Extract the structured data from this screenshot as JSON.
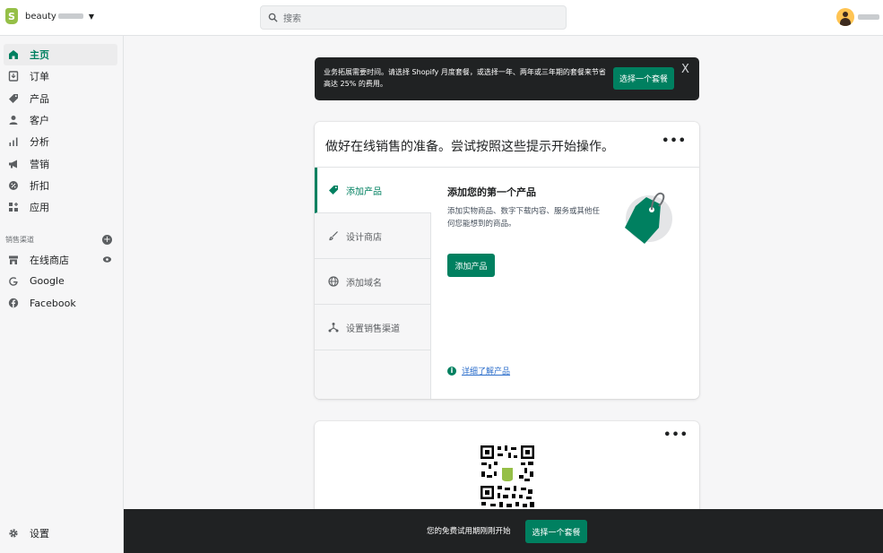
{
  "topbar": {
    "store_name": "beauty",
    "search_placeholder": "搜索"
  },
  "sidebar": {
    "items": [
      {
        "label": "主页",
        "icon": "home-icon"
      },
      {
        "label": "订单",
        "icon": "orders-icon"
      },
      {
        "label": "产品",
        "icon": "tag-icon"
      },
      {
        "label": "客户",
        "icon": "person-icon"
      },
      {
        "label": "分析",
        "icon": "bar-chart-icon"
      },
      {
        "label": "营销",
        "icon": "megaphone-icon"
      },
      {
        "label": "折扣",
        "icon": "discount-icon"
      },
      {
        "label": "应用",
        "icon": "apps-icon"
      }
    ],
    "channels_heading": "销售渠道",
    "channels": [
      {
        "label": "在线商店",
        "icon": "store-icon"
      },
      {
        "label": "Google",
        "icon": "google-icon"
      },
      {
        "label": "Facebook",
        "icon": "facebook-icon"
      }
    ],
    "settings_label": "设置"
  },
  "banner": {
    "text": "业务拓展需要时间。请选择 Shopify 月度套餐，或选择一年、两年或三年期的套餐来节省高达 25% 的费用。",
    "button": "选择一个套餐",
    "close": "X"
  },
  "setup_card": {
    "title": "做好在线销售的准备。尝试按照这些提示开始操作。",
    "menu": "•••",
    "tabs": [
      {
        "label": "添加产品",
        "icon": "tag-icon"
      },
      {
        "label": "设计商店",
        "icon": "brush-icon"
      },
      {
        "label": "添加域名",
        "icon": "globe-icon"
      },
      {
        "label": "设置销售渠道",
        "icon": "channels-icon"
      }
    ],
    "detail_title": "添加您的第一个产品",
    "detail_desc": "添加实物商品、数字下载内容、服务或其他任何您能想到的商品。",
    "detail_button": "添加产品",
    "learn_more": "详细了解产品"
  },
  "qr_card": {
    "menu": "•••"
  },
  "bottom_bar": {
    "text": "您的免费试用期刚刚开始",
    "button": "选择一个套餐"
  },
  "colors": {
    "accent": "#008060",
    "dark": "#202223",
    "link": "#2c6ecb"
  }
}
